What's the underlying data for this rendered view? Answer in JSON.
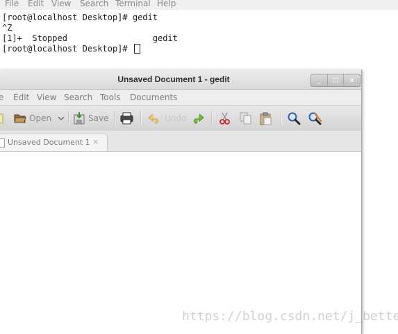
{
  "terminal": {
    "menu": [
      "File",
      "Edit",
      "View",
      "Search",
      "Terminal",
      "Help"
    ],
    "lines": [
      "[root@localhost Desktop]# gedit",
      "^Z",
      "[1]+  Stopped                 gedit",
      "[root@localhost Desktop]# "
    ]
  },
  "gedit": {
    "title": "Unsaved Document 1 - gedit",
    "window_buttons": [
      "_",
      "□",
      "×"
    ],
    "menu": [
      "e",
      "Edit",
      "View",
      "Search",
      "Tools",
      "Documents"
    ],
    "toolbar": {
      "open_label": "Open",
      "save_label": "Save",
      "undo_label": "Undo"
    },
    "tab": {
      "label": "Unsaved Document 1",
      "close": "×"
    }
  },
  "watermark": "https://blog.csdn.net/j_better",
  "colors": {
    "undo_arrow": "#e8c96a",
    "redo_arrow": "#6fbf3c",
    "cut_scissors": "#cc2a2a",
    "search_lens": "#2d5fa8"
  }
}
